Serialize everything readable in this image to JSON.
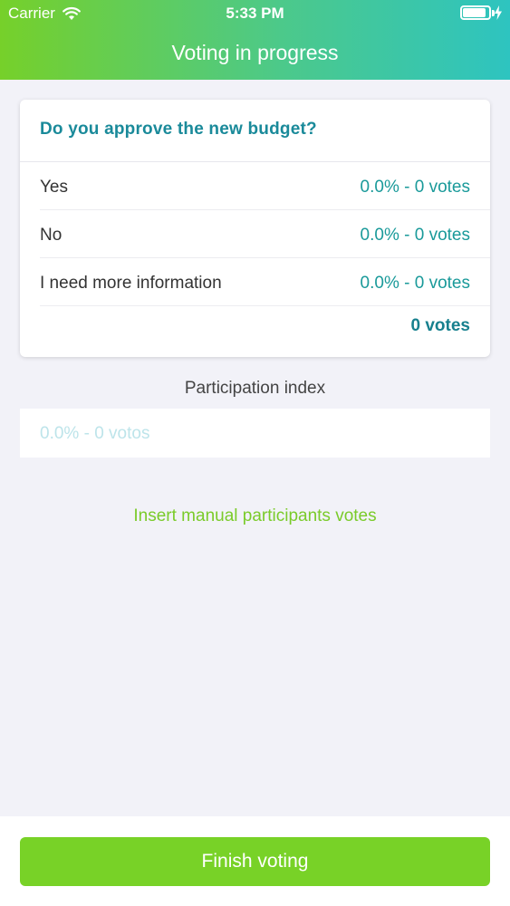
{
  "status_bar": {
    "carrier": "Carrier",
    "time": "5:33 PM",
    "wifi_icon": "wifi-icon",
    "battery_icon": "battery-icon",
    "charging_icon": "bolt-icon",
    "battery_level": 0.95
  },
  "nav": {
    "title": "Voting in progress",
    "gradient_start": "#76d02a",
    "gradient_end": "#2ec4c0"
  },
  "poll": {
    "question": "Do you approve the new budget?",
    "options": [
      {
        "label": "Yes",
        "result": "0.0% - 0 votes"
      },
      {
        "label": "No",
        "result": "0.0% - 0 votes"
      },
      {
        "label": "I need more information",
        "result": "0.0% - 0 votes"
      }
    ],
    "total": "0 votes"
  },
  "participation": {
    "label": "Participation index",
    "value": "0.0% - 0 votos"
  },
  "manual_link": "Insert manual participants votes",
  "finish_button": {
    "label": "Finish voting",
    "color": "#78d227"
  },
  "colors": {
    "accent_teal": "#1a8a9a",
    "accent_green": "#7acb2a",
    "background": "#f2f2f8"
  }
}
